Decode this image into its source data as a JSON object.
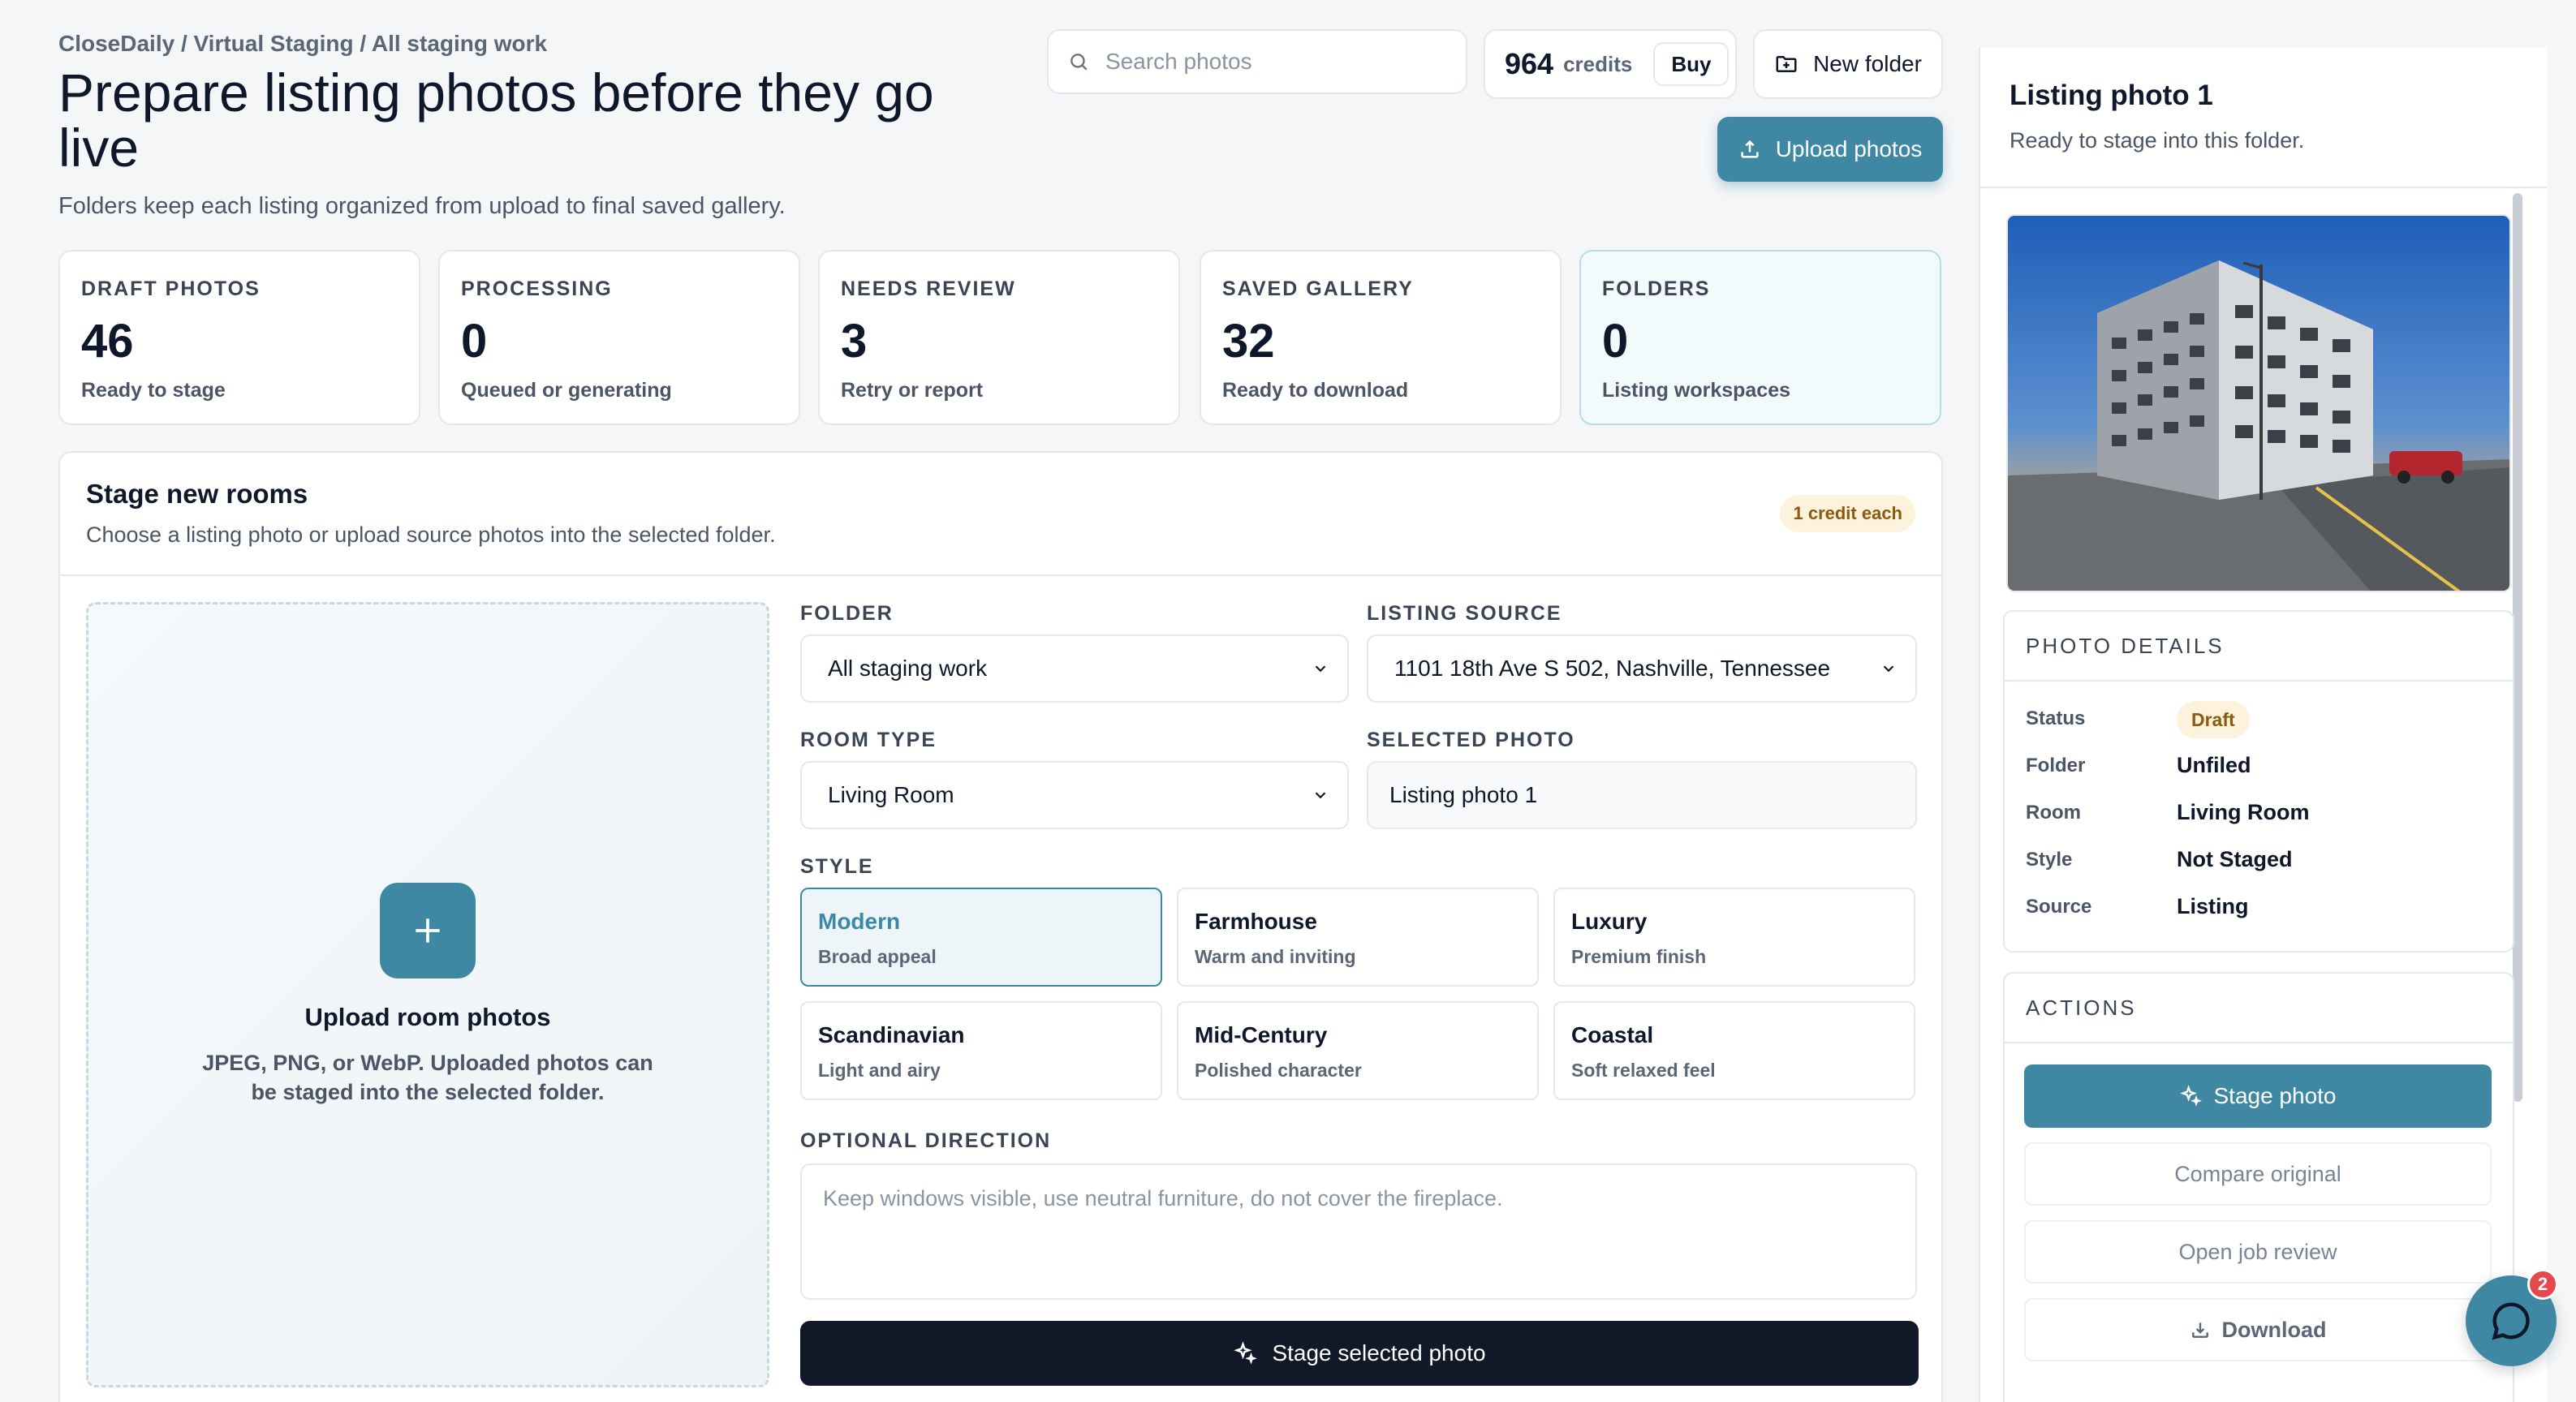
{
  "breadcrumb": "CloseDaily / Virtual Staging / All staging work",
  "page_title": "Prepare listing photos before they go live",
  "subtitle": "Folders keep each listing organized from upload to final saved gallery.",
  "search": {
    "placeholder": "Search photos"
  },
  "credits": {
    "value": "964",
    "label": "credits",
    "buy_label": "Buy"
  },
  "new_folder_label": "New folder",
  "upload_label": "Upload photos",
  "stats": [
    {
      "caption": "DRAFT PHOTOS",
      "value": "46",
      "sub": "Ready to stage"
    },
    {
      "caption": "PROCESSING",
      "value": "0",
      "sub": "Queued or generating"
    },
    {
      "caption": "NEEDS REVIEW",
      "value": "3",
      "sub": "Retry or report"
    },
    {
      "caption": "SAVED GALLERY",
      "value": "32",
      "sub": "Ready to download"
    },
    {
      "caption": "FOLDERS",
      "value": "0",
      "sub": "Listing workspaces"
    }
  ],
  "stage": {
    "title": "Stage new rooms",
    "subtitle": "Choose a listing photo or upload source photos into the selected folder.",
    "credit_badge": "1 credit each",
    "dropzone": {
      "title": "Upload room photos",
      "subtitle": "JPEG, PNG, or WebP. Uploaded photos can be staged into the selected folder."
    },
    "folder_label": "FOLDER",
    "folder_value": "All staging work",
    "source_label": "LISTING SOURCE",
    "source_value": "1101 18th Ave S 502, Nashville, Tennessee",
    "room_label": "ROOM TYPE",
    "room_value": "Living Room",
    "selected_label": "SELECTED PHOTO",
    "selected_value": "Listing photo 1",
    "style_label": "STYLE",
    "styles": [
      {
        "name": "Modern",
        "desc": "Broad appeal",
        "selected": true
      },
      {
        "name": "Farmhouse",
        "desc": "Warm and inviting"
      },
      {
        "name": "Luxury",
        "desc": "Premium finish"
      },
      {
        "name": "Scandinavian",
        "desc": "Light and airy"
      },
      {
        "name": "Mid-Century",
        "desc": "Polished character"
      },
      {
        "name": "Coastal",
        "desc": "Soft relaxed feel"
      }
    ],
    "direction_label": "OPTIONAL DIRECTION",
    "direction_placeholder": "Keep windows visible, use neutral furniture, do not cover the fireplace.",
    "stage_selected_label": "Stage selected photo"
  },
  "side": {
    "title": "Listing photo 1",
    "subtitle": "Ready to stage into this folder.",
    "details_caption": "PHOTO DETAILS",
    "details": [
      {
        "key": "Status",
        "value": "Draft"
      },
      {
        "key": "Folder",
        "value": "Unfiled"
      },
      {
        "key": "Room",
        "value": "Living Room"
      },
      {
        "key": "Style",
        "value": "Not Staged"
      },
      {
        "key": "Source",
        "value": "Listing"
      }
    ],
    "actions_caption": "ACTIONS",
    "actions": {
      "stage": "Stage photo",
      "compare": "Compare original",
      "review": "Open job review",
      "download": "Download"
    }
  },
  "chat_badge": "2",
  "colors": {
    "accent": "#3f88a4",
    "dark_button": "#111827",
    "draft_badge_bg": "#fdf3dc"
  },
  "icons": [
    "search-icon",
    "folder-plus-icon",
    "upload-icon",
    "plus-icon",
    "chevron-down-icon",
    "sparkles-icon",
    "download-icon",
    "chat-icon"
  ]
}
